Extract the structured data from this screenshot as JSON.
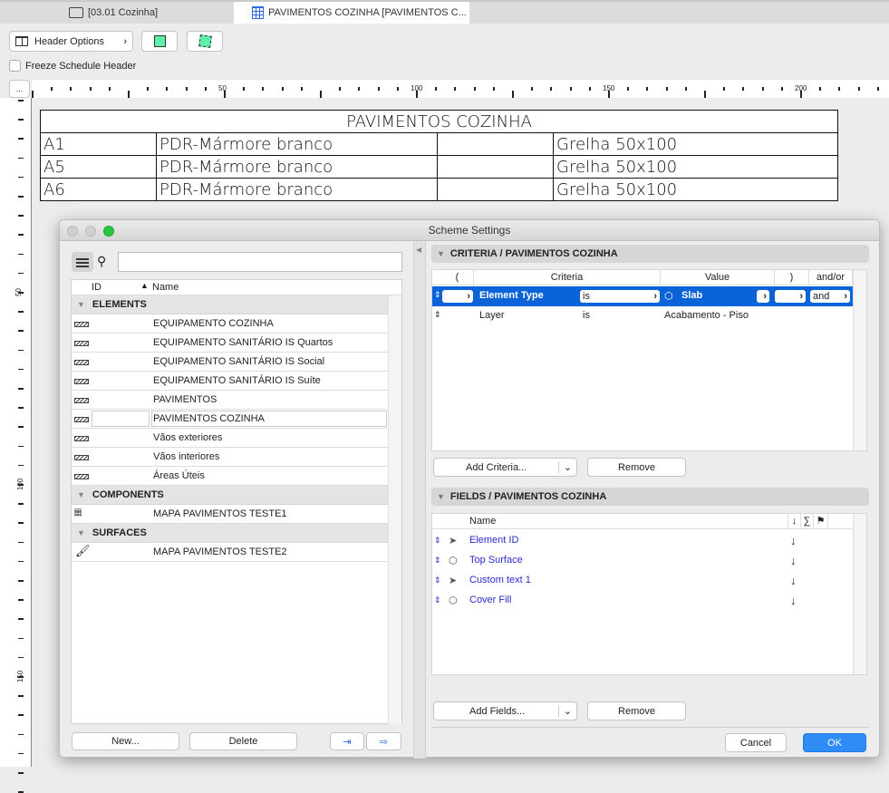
{
  "tabs": [
    {
      "label": "[03.01 Cozinha]",
      "icon": "layout-icon"
    },
    {
      "label": "PAVIMENTOS COZINHA [PAVIMENTOS C...",
      "icon": "schedule-grid-icon",
      "active": true
    }
  ],
  "toolbar": {
    "header_options": "Header Options",
    "freeze_label": "Freeze Schedule Header",
    "freeze_checked": false,
    "more_label": "..."
  },
  "ruler": {
    "top_labels": [
      "50",
      "100",
      "150",
      "200"
    ],
    "left_labels": [
      "50",
      "100",
      "150"
    ]
  },
  "schedule": {
    "title": "PAVIMENTOS COZINHA",
    "rows": [
      [
        "A1",
        "PDR-Mármore branco",
        "",
        "Grelha 50x100"
      ],
      [
        "A5",
        "PDR-Mármore branco",
        "",
        "Grelha 50x100"
      ],
      [
        "A6",
        "PDR-Mármore branco",
        "",
        "Grelha 50x100"
      ]
    ]
  },
  "dialog": {
    "title": "Scheme Settings",
    "list": {
      "col_id": "ID",
      "col_name": "Name",
      "groups": [
        {
          "name": "ELEMENTS",
          "icon": "hatch-icon",
          "items": [
            "EQUIPAMENTO COZINHA",
            "EQUIPAMENTO SANITÁRIO IS Quartos",
            "EQUIPAMENTO SANITÁRIO IS Social",
            "EQUIPAMENTO SANITÁRIO IS Suíte",
            "PAVIMENTOS",
            "PAVIMENTOS COZINHA",
            "Vãos exteriores",
            "Vãos interiores",
            "Áreas Úteis"
          ],
          "selected": "PAVIMENTOS COZINHA"
        },
        {
          "name": "COMPONENTS",
          "icon": "bricks-icon",
          "items": [
            "MAPA PAVIMENTOS TESTE1"
          ]
        },
        {
          "name": "SURFACES",
          "icon": "paint-brush-icon",
          "items": [
            "MAPA PAVIMENTOS TESTE2"
          ]
        }
      ]
    },
    "new_label": "New...",
    "delete_label": "Delete",
    "criteria": {
      "title": "CRITERIA /  PAVIMENTOS COZINHA",
      "headers": [
        "(",
        "Criteria",
        "Value",
        ")",
        "and/or"
      ],
      "rows": [
        {
          "criteria": "Element Type",
          "op": "is",
          "value": "Slab",
          "andor": "and",
          "selected": true
        },
        {
          "criteria": "Layer",
          "op": "is",
          "value": "Acabamento - Piso",
          "andor": ""
        }
      ],
      "add_label": "Add Criteria...",
      "remove_label": "Remove"
    },
    "fields": {
      "title": "FIELDS /  PAVIMENTOS COZINHA",
      "header_name": "Name",
      "header_sort": "↓",
      "header_sum": "∑",
      "rows": [
        {
          "name": "Element ID",
          "icon": "cursor-arrow-icon",
          "sort": "↓"
        },
        {
          "name": "Top Surface",
          "icon": "slab-icon",
          "sort": "↓"
        },
        {
          "name": "Custom text  1",
          "icon": "cursor-arrow-icon",
          "sort": "↓"
        },
        {
          "name": "Cover Fill",
          "icon": "slab-icon",
          "sort": "↓"
        }
      ],
      "add_label": "Add Fields...",
      "remove_label": "Remove"
    },
    "cancel_label": "Cancel",
    "ok_label": "OK"
  },
  "colors": {
    "selection": "#0a64d8",
    "ok": "#2f8cf5",
    "field_text": "#2a2ad0"
  }
}
